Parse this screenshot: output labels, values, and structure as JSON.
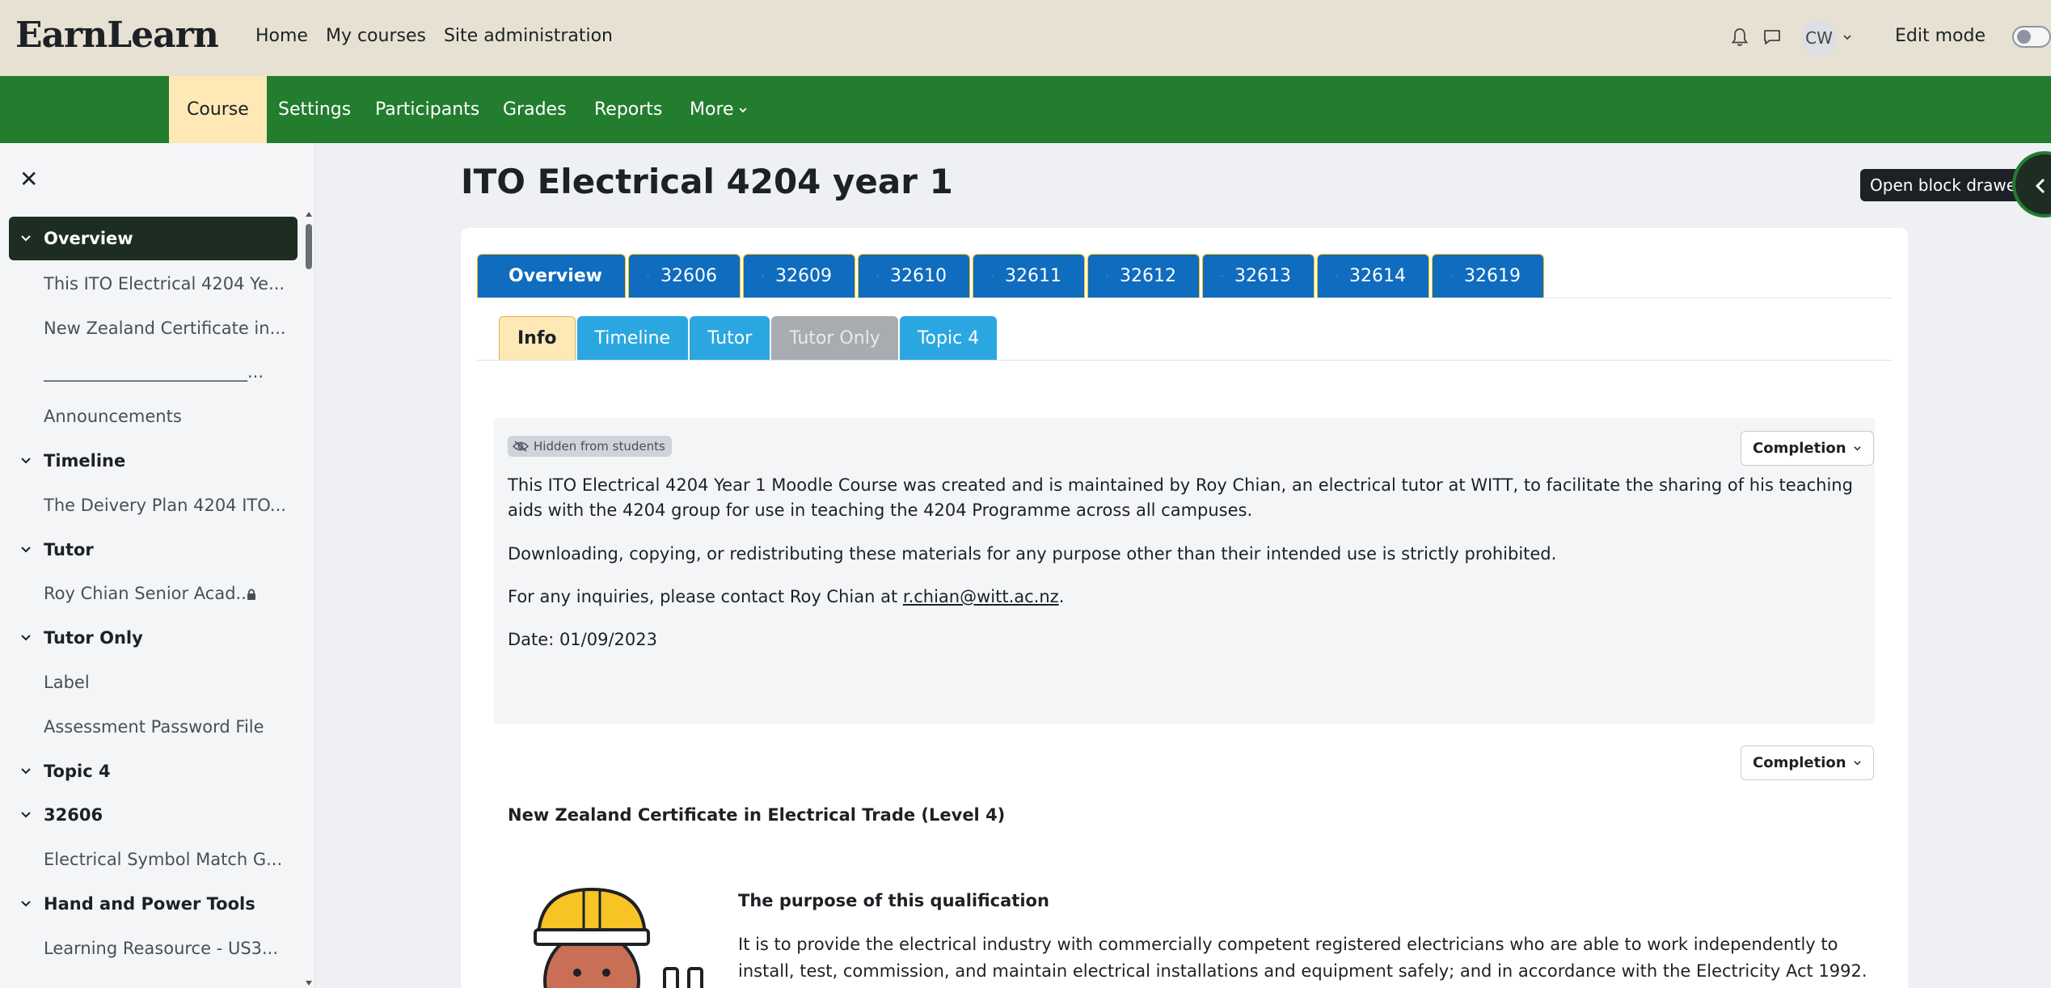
{
  "brand": {
    "logo": "EarnLearn"
  },
  "topnav": {
    "home": "Home",
    "my_courses": "My courses",
    "site_admin": "Site administration"
  },
  "user": {
    "initials": "CW",
    "edit_mode_label": "Edit mode",
    "edit_mode_on": false
  },
  "course_nav": {
    "course": "Course",
    "settings": "Settings",
    "participants": "Participants",
    "grades": "Grades",
    "reports": "Reports",
    "more": "More"
  },
  "drawer": {
    "items": [
      {
        "label": "Overview",
        "type": "section",
        "active": true
      },
      {
        "label": "This ITO Electrical 4204 Ye...",
        "type": "activity"
      },
      {
        "label": "New Zealand Certificate in...",
        "type": "activity"
      },
      {
        "label": "________________________...",
        "type": "activity"
      },
      {
        "label": "Announcements",
        "type": "activity"
      },
      {
        "label": "Timeline",
        "type": "section"
      },
      {
        "label": "The Deivery Plan 4204 ITO...",
        "type": "activity"
      },
      {
        "label": "Tutor",
        "type": "section"
      },
      {
        "label": "Roy Chian Senior Acad...",
        "type": "activity",
        "locked": true
      },
      {
        "label": "Tutor Only",
        "type": "section"
      },
      {
        "label": "Label",
        "type": "activity"
      },
      {
        "label": "Assessment Password File",
        "type": "activity"
      },
      {
        "label": "Topic 4",
        "type": "section"
      },
      {
        "label": "32606",
        "type": "section"
      },
      {
        "label": "Electrical Symbol Match G...",
        "type": "activity"
      },
      {
        "label": "Hand and Power Tools",
        "type": "section"
      },
      {
        "label": "Learning Reasource - US3...",
        "type": "activity"
      }
    ]
  },
  "page": {
    "title": "ITO Electrical 4204 year 1",
    "block_drawer_tooltip": "Open block drawer"
  },
  "section_tabs": [
    "Overview",
    "32606",
    "32609",
    "32610",
    "32611",
    "32612",
    "32613",
    "32614",
    "32619"
  ],
  "sub_tabs": [
    "Info",
    "Timeline",
    "Tutor",
    "Tutor Only",
    "Topic 4"
  ],
  "info": {
    "hidden_badge": "Hidden from students",
    "completion": "Completion",
    "p1": "This ITO Electrical 4204 Year 1 Moodle Course  was created and is maintained by Roy Chian, an electrical tutor at WITT, to facilitate the sharing of his teaching aids with the 4204 group for use in teaching the 4204 Programme across all campuses.",
    "p2": "Downloading, copying, or redistributing these materials for any purpose other than their intended use is strictly prohibited.",
    "p3_prefix": "For any inquiries, please contact Roy Chian at ",
    "p3_email": "r.chian@witt.ac.nz",
    "p3_suffix": ".",
    "p4": "Date: 01/09/2023"
  },
  "qualification": {
    "completion": "Completion",
    "title": "New Zealand Certificate in Electrical Trade (Level 4)",
    "purpose_title": "The purpose of this qualification",
    "purpose_text": "It is to provide the electrical industry with commercially competent registered electricians who are able to work independently to install, test, commission, and maintain electrical installations and equipment safely; and in accordance with the Electricity Act 1992."
  },
  "colors": {
    "topbar": "#e6e1d2",
    "course_nav": "#237d2f",
    "active_tab": "#fde8b6",
    "section_tab": "#0f6cbf",
    "sub_tab": "#2aa7e0",
    "drawer_active": "#1d2d22"
  }
}
